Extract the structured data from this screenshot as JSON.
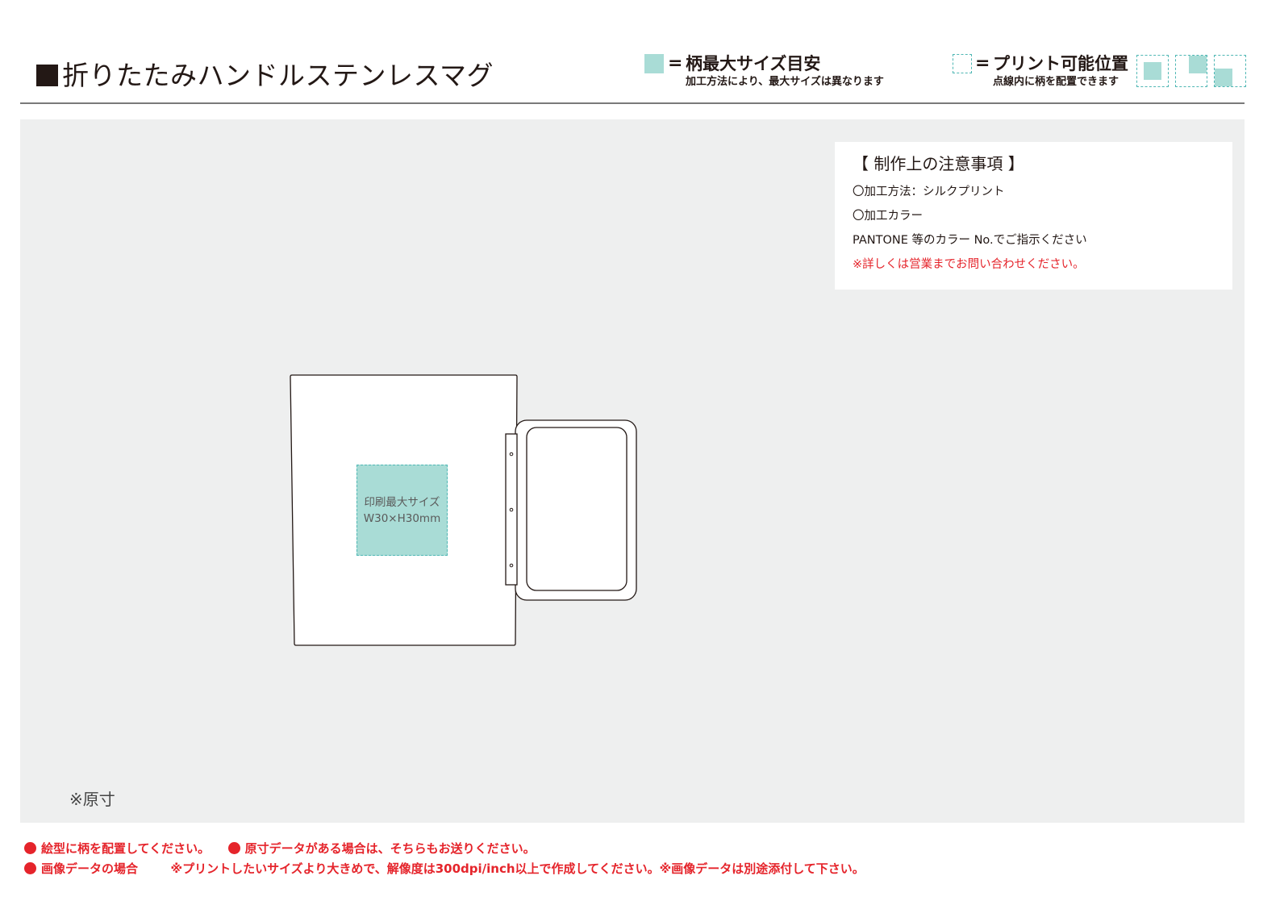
{
  "header": {
    "title": "折りたたみハンドルステンレスマグ"
  },
  "legend": {
    "max_size": {
      "equals": "=",
      "label": "柄最大サイズ目安",
      "note": "加工方法により、最大サイズは異なります"
    },
    "print_position": {
      "equals": "=",
      "label": "プリント可能位置",
      "note": "点線内に柄を配置できます"
    }
  },
  "notes": {
    "title": "【 制作上の注意事項 】",
    "method": "〇加工方法：シルクプリント",
    "color_heading": "〇加工カラー",
    "color_instruction": "PANTONE 等のカラー No.でご指示ください",
    "contact": "※詳しくは営業までお問い合わせください。"
  },
  "print_area": {
    "label": "印刷最大サイズ",
    "size": "W30×H30mm"
  },
  "scale_note": "※原寸",
  "footer": {
    "line1_a": "絵型に柄を配置してください。",
    "line1_b": "原寸データがある場合は、そちらもお送りください。",
    "line2_a": "画像データの場合",
    "line2_b": "※プリントしたいサイズより大きめで、解像度は300dpi/inch以上で作成してください。※画像データは別途添付して下さい。"
  },
  "colors": {
    "swatch_fill": "#a9dcd6",
    "dashed_border": "#4fb7b4",
    "panel_bg": "#eeefef",
    "accent_red": "#e5242b",
    "text": "#231815"
  }
}
